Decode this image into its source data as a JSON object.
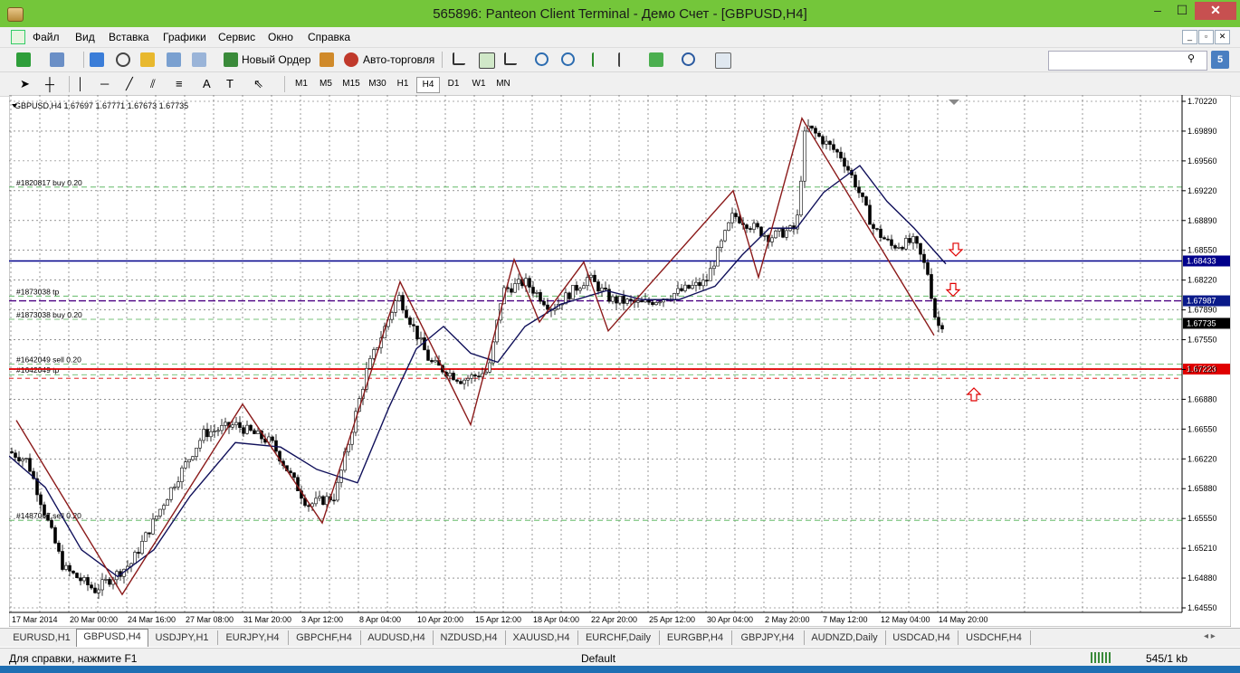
{
  "window": {
    "title": "565896: Panteon Client Terminal - Демо Счет - [GBPUSD,H4]",
    "min_glyph": "–",
    "max_glyph": "☐",
    "close_glyph": "✕"
  },
  "menu": {
    "items": [
      "Файл",
      "Вид",
      "Вставка",
      "Графики",
      "Сервис",
      "Окно",
      "Справка"
    ],
    "mdi_buttons": [
      "_",
      "▫",
      "✕"
    ]
  },
  "toolbar": {
    "new_order_label": "Новый Ордер",
    "auto_trading_label": "Авто-торговля",
    "help_label": "5",
    "search_value": ""
  },
  "timeframes": [
    "M1",
    "M5",
    "M15",
    "M30",
    "H1",
    "H4",
    "D1",
    "W1",
    "MN"
  ],
  "active_timeframe": "H4",
  "chart": {
    "header": "GBPUSD,H4  1.67697 1.67771 1.67673 1.67735",
    "price_labels": [
      "1.70220",
      "1.69890",
      "1.69560",
      "1.69220",
      "1.68890",
      "1.68550",
      "1.68220",
      "1.67890",
      "1.67550",
      "1.67220",
      "1.66880",
      "1.66550",
      "1.66220",
      "1.65880",
      "1.65550",
      "1.65210",
      "1.64880",
      "1.64550"
    ],
    "date_labels": [
      "17 Mar 2014",
      "20 Mar 00:00",
      "24 Mar 16:00",
      "27 Mar 08:00",
      "31 Mar 20:00",
      "3 Apr 12:00",
      "8 Apr 04:00",
      "10 Apr 20:00",
      "15 Apr 12:00",
      "18 Apr 04:00",
      "22 Apr 20:00",
      "25 Apr 12:00",
      "30 Apr 04:00",
      "2 May 20:00",
      "7 May 12:00",
      "12 May 04:00",
      "14 May 20:00"
    ],
    "lines": {
      "blue": {
        "price": 1.68433,
        "label": "1.68433",
        "color": "#00008b"
      },
      "purple": {
        "price": 1.67987,
        "label": "1.67987",
        "color": "#4b0082"
      },
      "current": {
        "price": 1.67735,
        "label": "1.67735"
      },
      "red": {
        "price": 1.67223,
        "label": "1.67223",
        "color": "#e00000"
      }
    },
    "order_labels": [
      {
        "text": "#1820817 buy 0.20",
        "price": 1.6926
      },
      {
        "text": "#1873038 tp",
        "price": 1.6804
      },
      {
        "text": "#1873038 buy 0.20",
        "price": 1.6778
      },
      {
        "text": "#1642049 sell 0.20",
        "price": 1.6728
      },
      {
        "text": "#1642049 tp",
        "price": 1.6716
      },
      {
        "text": "#1487067 sell 0.20",
        "price": 1.6553
      }
    ],
    "colors": {
      "zigzag": "#8b1a1a",
      "ma": "#10105a",
      "grid": "#444444",
      "green_dash": "#4caf50"
    }
  },
  "tabs": [
    "EURUSD,H1",
    "GBPUSD,H4",
    "USDJPY,H1",
    "EURJPY,H4",
    "GBPCHF,H4",
    "AUDUSD,H4",
    "NZDUSD,H4",
    "XAUUSD,H4",
    "EURCHF,Daily",
    "EURGBP,H4",
    "GBPJPY,H4",
    "AUDNZD,Daily",
    "USDCAD,H4",
    "USDCHF,H4"
  ],
  "active_tab": "GBPUSD,H4",
  "status": {
    "help": "Для справки, нажмите F1",
    "profile": "Default",
    "traffic": "545/1 kb"
  }
}
